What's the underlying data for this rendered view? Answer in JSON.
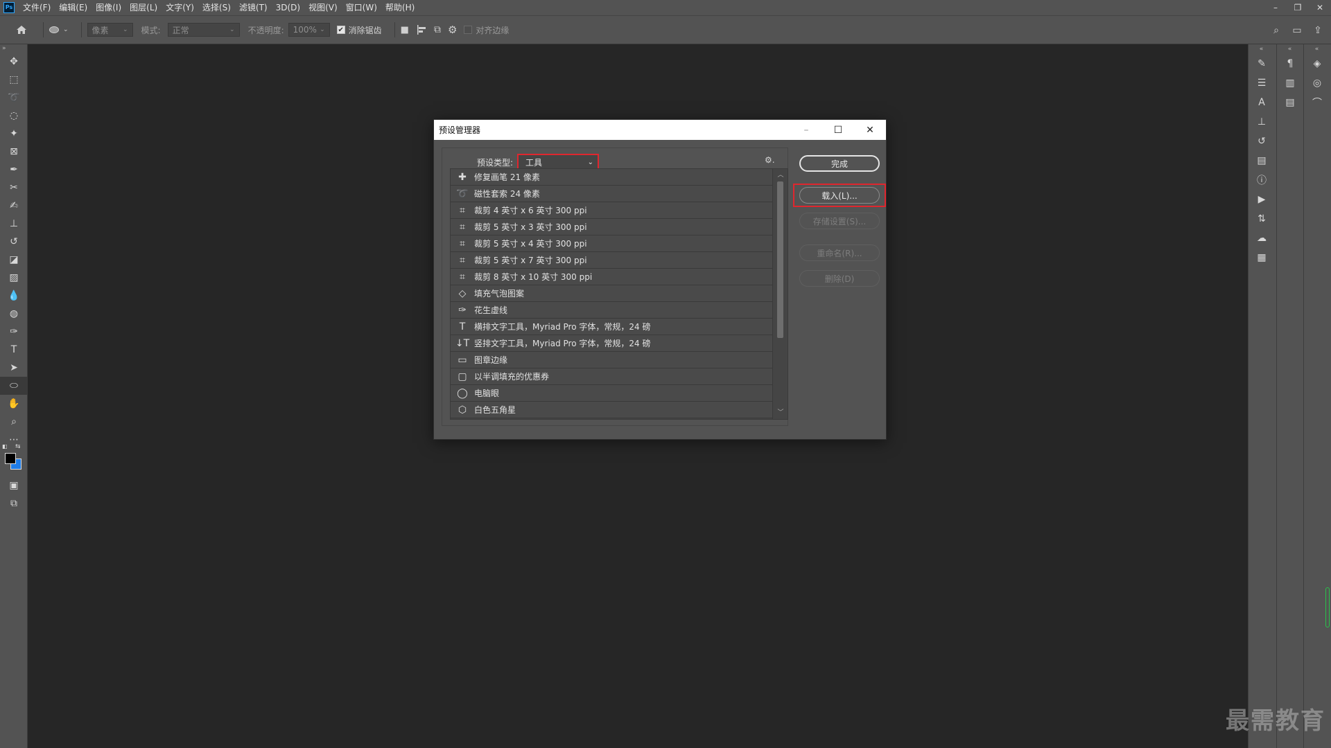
{
  "app": {
    "logo": "Ps"
  },
  "menu": [
    "文件(F)",
    "编辑(E)",
    "图像(I)",
    "图层(L)",
    "文字(Y)",
    "选择(S)",
    "滤镜(T)",
    "3D(D)",
    "视图(V)",
    "窗口(W)",
    "帮助(H)"
  ],
  "window_controls": {
    "minimize": "–",
    "restore": "❐",
    "close": "✕"
  },
  "options": {
    "unit_value": "像素",
    "mode_label": "模式:",
    "mode_value": "正常",
    "opacity_label": "不透明度:",
    "opacity_value": "100%",
    "antialias_label": "消除锯齿",
    "antialias_checked": true,
    "align_edges_label": "对齐边缘",
    "align_edges_checked": false
  },
  "tools": [
    "move-tool-icon",
    "marquee-tool-icon",
    "lasso-tool-icon",
    "quick-select-tool-icon",
    "magic-wand-tool-icon",
    "frame-tool-icon",
    "eyedropper-tool-icon",
    "crop-scissors-icon",
    "brush-tool-icon",
    "clone-stamp-tool-icon",
    "history-brush-tool-icon",
    "eraser-tool-icon",
    "gradient-tool-icon",
    "blur-tool-icon",
    "dodge-tool-icon",
    "pen-tool-icon",
    "type-tool-icon",
    "path-select-tool-icon",
    "ellipse-tool-icon",
    "hand-tool-icon",
    "zoom-tool-icon",
    "more-tools-icon"
  ],
  "colors": {
    "foreground": "#000000",
    "background": "#1f7ce6",
    "highlight": "#e0262e"
  },
  "dialog": {
    "title": "预设管理器",
    "type_label": "预设类型:",
    "type_value": "工具",
    "buttons": {
      "done": "完成",
      "load": "载入(L)...",
      "save": "存储设置(S)...",
      "rename": "重命名(R)...",
      "delete": "删除(D)"
    },
    "items": [
      {
        "icon": "healing-brush-icon",
        "label": "修复画笔 21 像素"
      },
      {
        "icon": "magnetic-lasso-icon",
        "label": "磁性套索 24 像素"
      },
      {
        "icon": "crop-icon",
        "label": "裁剪 4 英寸 x 6 英寸 300 ppi"
      },
      {
        "icon": "crop-icon",
        "label": "裁剪 5 英寸 x 3 英寸 300 ppi"
      },
      {
        "icon": "crop-icon",
        "label": "裁剪 5 英寸 x 4 英寸 300 ppi"
      },
      {
        "icon": "crop-icon",
        "label": "裁剪 5 英寸 x 7 英寸 300 ppi"
      },
      {
        "icon": "crop-icon",
        "label": "裁剪 8 英寸 x 10 英寸 300 ppi"
      },
      {
        "icon": "paint-bucket-icon",
        "label": "填充气泡图案"
      },
      {
        "icon": "pen-icon",
        "label": "花生虚线"
      },
      {
        "icon": "horizontal-type-icon",
        "label": "横排文字工具，Myriad Pro 字体，常规，24 磅"
      },
      {
        "icon": "vertical-type-icon",
        "label": "竖排文字工具，Myriad Pro 字体，常规，24 磅"
      },
      {
        "icon": "rectangle-shape-icon",
        "label": "图章边缘"
      },
      {
        "icon": "rounded-rect-shape-icon",
        "label": "以半调填充的优惠券"
      },
      {
        "icon": "ellipse-shape-icon",
        "label": "电脑眼"
      },
      {
        "icon": "polygon-shape-icon",
        "label": "白色五角星"
      }
    ]
  },
  "watermark": "最需教育"
}
